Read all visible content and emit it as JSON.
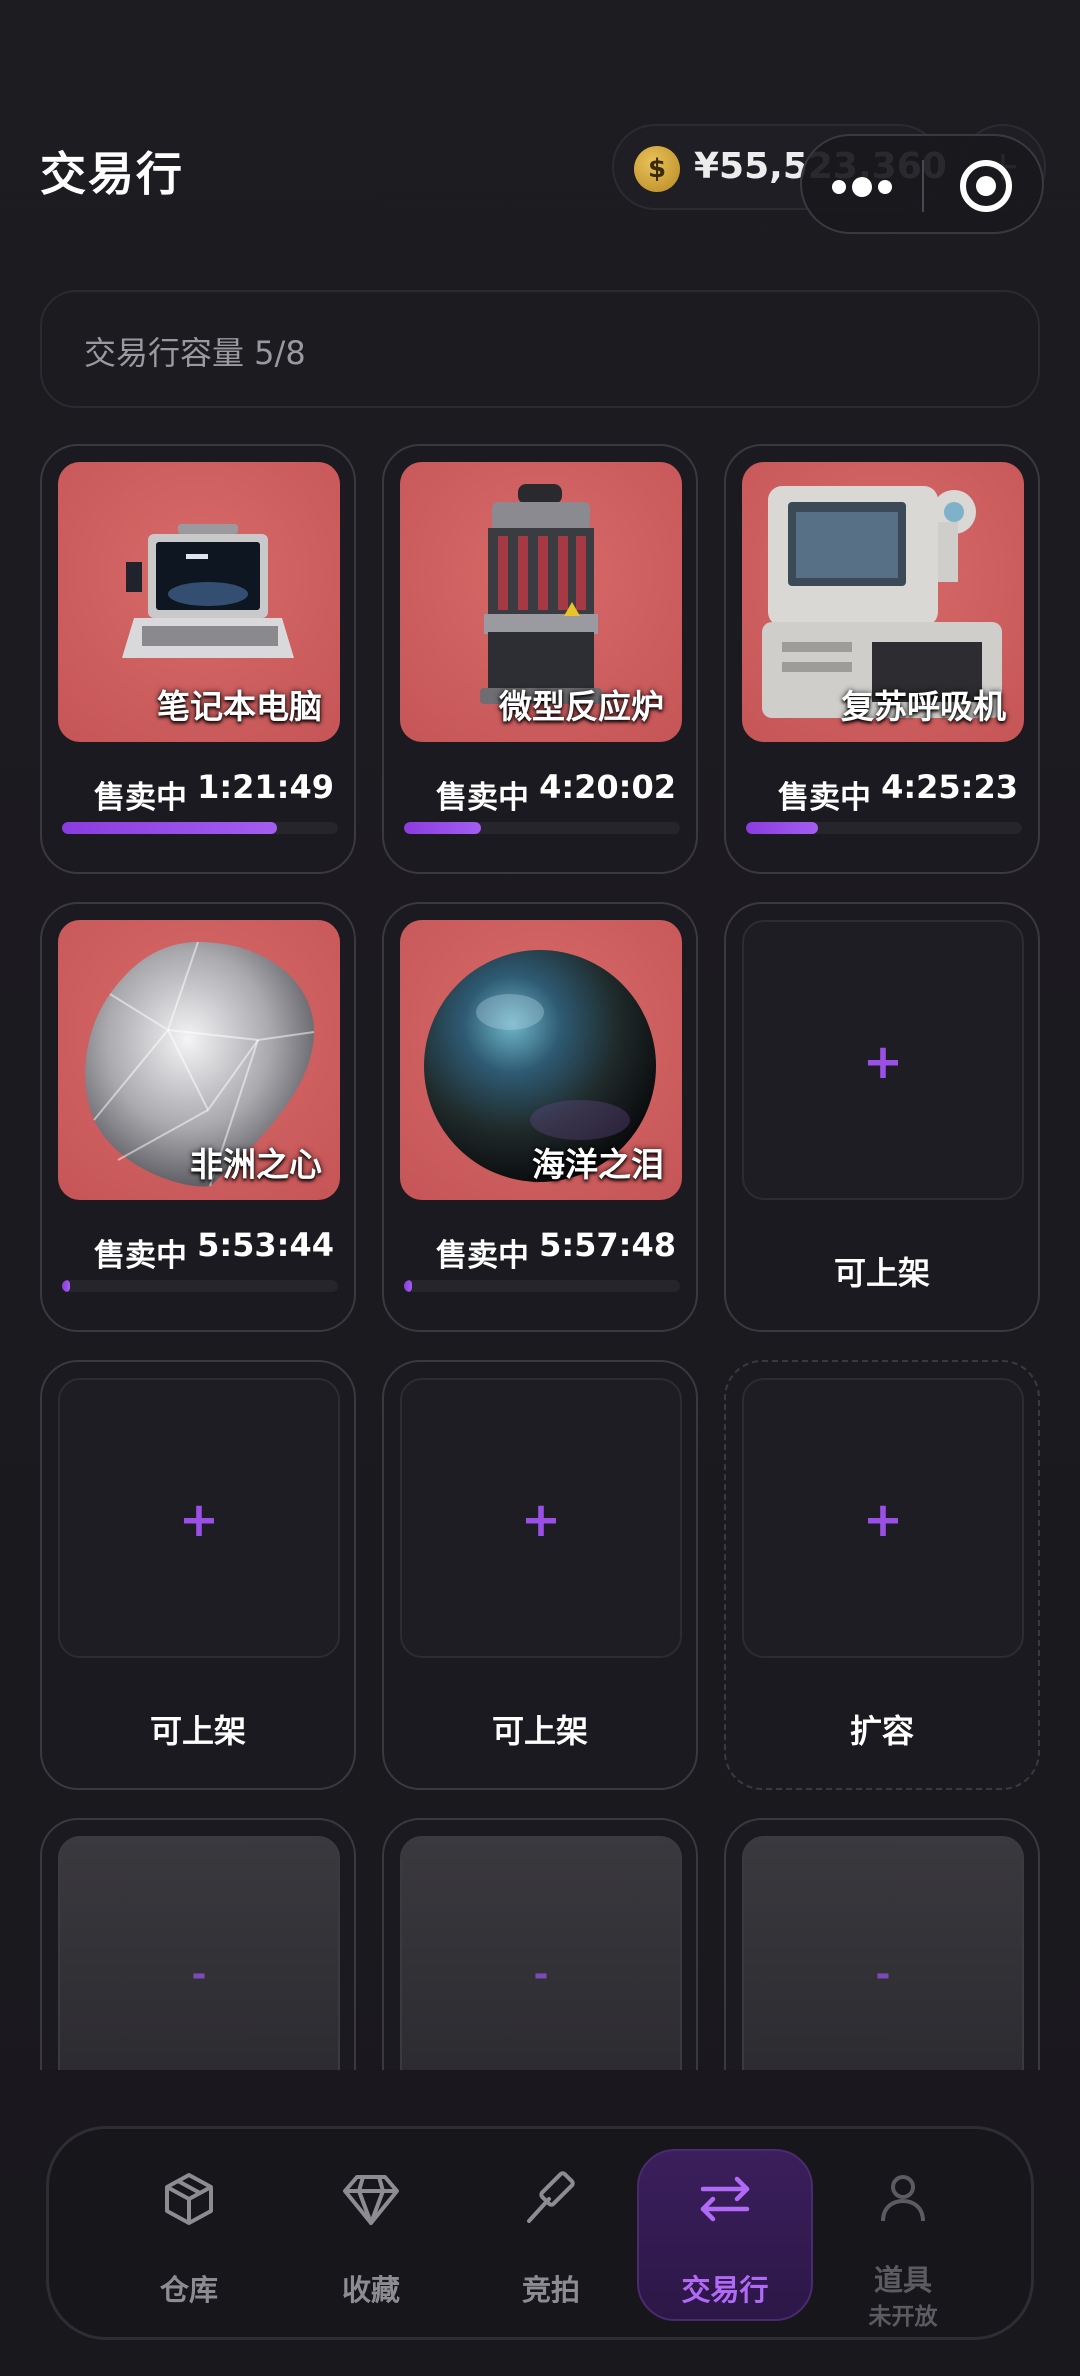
{
  "header": {
    "title": "交易行",
    "balance": "¥55,523,360",
    "coin_symbol": "$"
  },
  "capacity_label": "交易行容量 5/8",
  "listings": [
    {
      "name": "笔记本电脑",
      "status": "售卖中",
      "time_left": "1:21:49",
      "progress": 0.78
    },
    {
      "name": "微型反应炉",
      "status": "售卖中",
      "time_left": "4:20:02",
      "progress": 0.28
    },
    {
      "name": "复苏呼吸机",
      "status": "售卖中",
      "time_left": "4:25:23",
      "progress": 0.26
    },
    {
      "name": "非洲之心",
      "status": "售卖中",
      "time_left": "5:53:44",
      "progress": 0.03
    },
    {
      "name": "海洋之泪",
      "status": "售卖中",
      "time_left": "5:57:48",
      "progress": 0.03
    }
  ],
  "empty_slots": [
    {
      "label": "可上架",
      "icon": "+"
    },
    {
      "label": "可上架",
      "icon": "+"
    },
    {
      "label": "可上架",
      "icon": "+"
    },
    {
      "label": "扩容",
      "icon": "+"
    }
  ],
  "locked_slot_icon": "-",
  "nav": {
    "items": [
      {
        "label": "仓库",
        "icon": "box-icon"
      },
      {
        "label": "收藏",
        "icon": "diamond-icon"
      },
      {
        "label": "竞拍",
        "icon": "hammer-icon"
      },
      {
        "label": "交易行",
        "icon": "swap-arrows-icon"
      },
      {
        "label": "道具",
        "sub": "未开放",
        "icon": "person-icon"
      }
    ]
  },
  "colors": {
    "accent": "#9a4fe6",
    "item_background": "#c55556",
    "page_background": "#1b1a1f"
  }
}
